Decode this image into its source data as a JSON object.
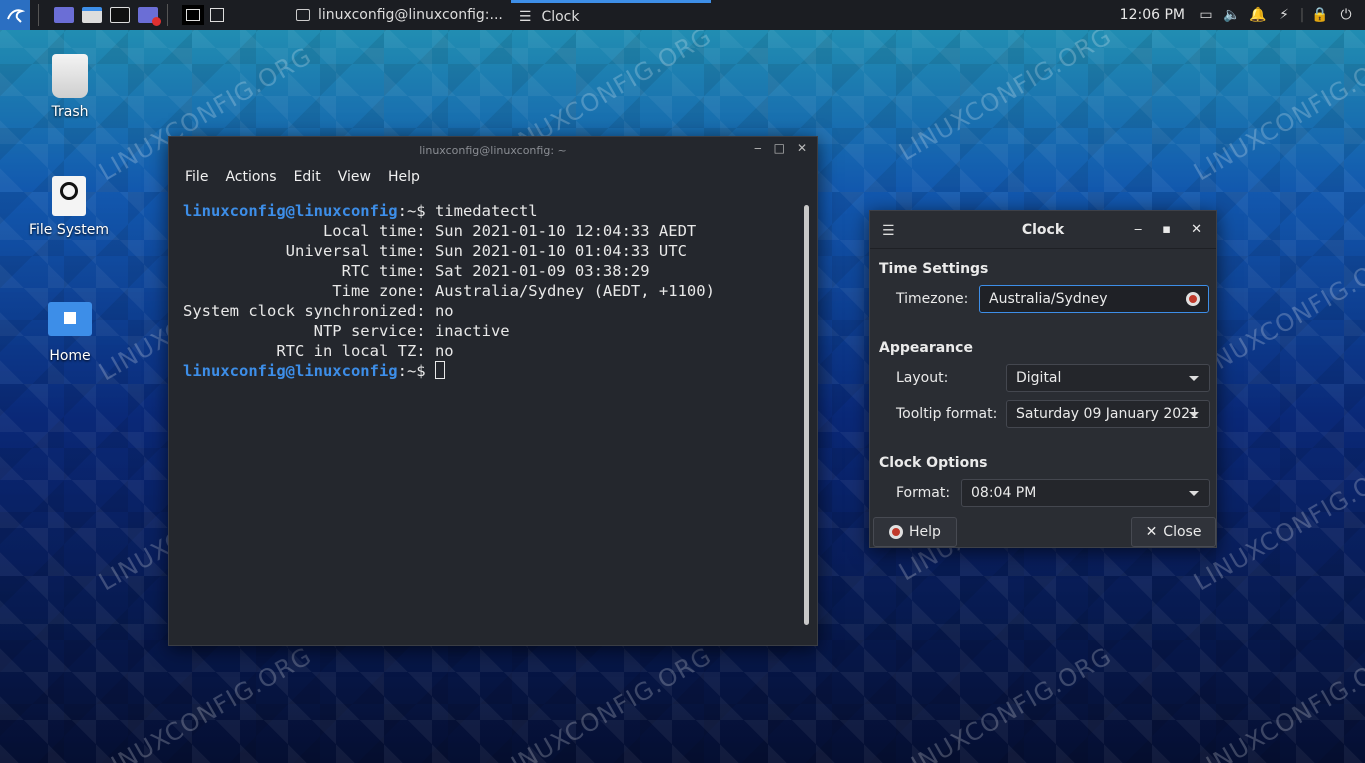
{
  "watermark": "LINUXCONFIG.ORG",
  "taskbar": {
    "tasks": [
      {
        "label": "linuxconfig@linuxconfig:..."
      },
      {
        "label": "Clock"
      }
    ],
    "time": "12:06 PM"
  },
  "desktop": {
    "icons": [
      {
        "label": "Trash"
      },
      {
        "label": "File System"
      },
      {
        "label": "Home"
      }
    ]
  },
  "terminal": {
    "title": "linuxconfig@linuxconfig: ~",
    "menu": [
      "File",
      "Actions",
      "Edit",
      "View",
      "Help"
    ],
    "prompt_user": "linuxconfig@linuxconfig",
    "prompt_suffix": ":~$ ",
    "command": "timedatectl",
    "output": [
      "               Local time: Sun 2021-01-10 12:04:33 AEDT",
      "           Universal time: Sun 2021-01-10 01:04:33 UTC",
      "                 RTC time: Sat 2021-01-09 03:38:29",
      "                Time zone: Australia/Sydney (AEDT, +1100)",
      "System clock synchronized: no",
      "              NTP service: inactive",
      "          RTC in local TZ: no"
    ]
  },
  "clock": {
    "title": "Clock",
    "time_settings": {
      "heading": "Time Settings",
      "timezone_label": "Timezone:",
      "timezone_value": "Australia/Sydney"
    },
    "appearance": {
      "heading": "Appearance",
      "layout_label": "Layout:",
      "layout_value": "Digital",
      "tooltip_label": "Tooltip format:",
      "tooltip_value": "Saturday 09 January 2021"
    },
    "clock_options": {
      "heading": "Clock Options",
      "format_label": "Format:",
      "format_value": "08:04 PM"
    },
    "help_label": "Help",
    "close_label": "Close"
  },
  "colors": {
    "accent": "#3d8ee8",
    "panel": "#1b1d22",
    "terminal_bg": "#24272d",
    "dialog_bg": "#2a2d33"
  }
}
